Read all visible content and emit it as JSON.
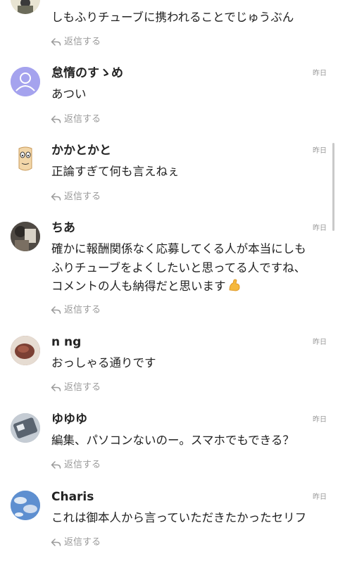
{
  "comments": [
    {
      "name": "",
      "time": "",
      "body": "しもふりチューブに携われることでじゅうぶん",
      "reply": "返信する",
      "avatar": "avatar-partial"
    },
    {
      "name": "怠惰のすゝめ",
      "time": "昨日",
      "body": "あつい",
      "reply": "返信する",
      "avatar": "default-user-icon"
    },
    {
      "name": "かかとかと",
      "time": "昨日",
      "body": "正論すぎて何も言えねぇ",
      "reply": "返信する",
      "avatar": "face-drawing"
    },
    {
      "name": "ちあ",
      "time": "昨日",
      "body": "確かに報酬関係なく応募してくる人が本当にしも\nふりチューブをよくしたいと思ってる人ですね、\nコメントの人も納得だと思います",
      "emoji": "flexed-biceps-emoji",
      "reply": "返信する",
      "avatar": "photo"
    },
    {
      "name": "n ng",
      "time": "昨日",
      "body": "おっしゃる通りです",
      "reply": "返信する",
      "avatar": "photo"
    },
    {
      "name": "ゆゆゆ",
      "time": "昨日",
      "body": "編集、パソコンないのー。スマホでもできる？",
      "reply": "返信する",
      "avatar": "photo"
    },
    {
      "name": "Charis",
      "time": "昨日",
      "body": "これは御本人から言っていただきたかったセリフ",
      "reply": "返信する",
      "avatar": "photo"
    }
  ],
  "colors": {
    "text": "#222222",
    "meta": "#9a9a9a",
    "default_avatar": "#a5a3ee"
  }
}
